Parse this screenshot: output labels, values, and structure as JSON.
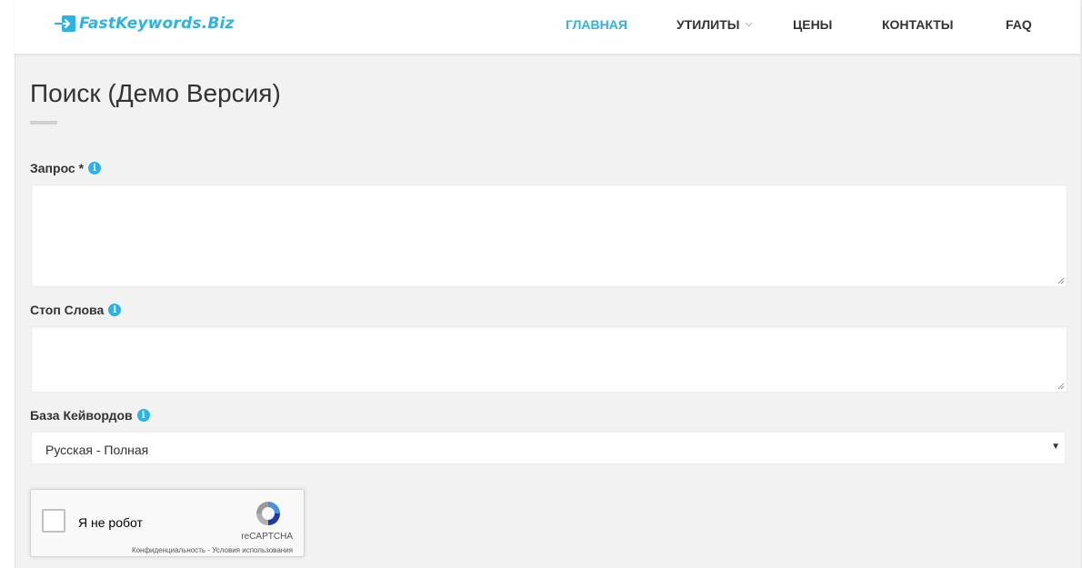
{
  "brand": {
    "name": "FastKeywords.Biz",
    "accent_color": "#2cb3e6"
  },
  "nav": {
    "items": [
      {
        "label": "Главная",
        "active": true
      },
      {
        "label": "Утилиты",
        "has_dropdown": true
      },
      {
        "label": "Цены"
      },
      {
        "label": "Контакты"
      },
      {
        "label": "FAQ"
      }
    ]
  },
  "page": {
    "title": "Поиск (Демо Версия)",
    "fields": {
      "query": {
        "label": "Запрос *",
        "icon": "info-icon",
        "value": ""
      },
      "stopwords": {
        "label": "Стоп Слова",
        "icon": "info-icon",
        "value": ""
      },
      "database": {
        "label": "База Кейвордов",
        "icon": "info-icon",
        "selected": "Русская - Полная"
      }
    }
  },
  "captcha": {
    "checkbox_label": "Я не робот",
    "brand": "reCAPTCHA",
    "privacy": "Конфиденциальность",
    "separator": " - ",
    "terms": "Условия использования"
  }
}
